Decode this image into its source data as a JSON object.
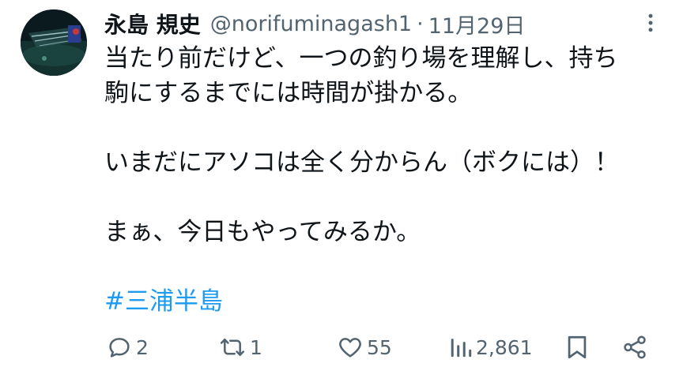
{
  "author": {
    "display_name": "永島 規史",
    "handle": "@norifuminagash1",
    "separator": "·",
    "date": "11月29日"
  },
  "tweet": {
    "lines": [
      "当たり前だけど、一つの釣り場を理解し、持ち",
      "駒にするまでには時間が掛かる。",
      "",
      "いまだにアソコは全く分からん（ボクには）！",
      "",
      "まぁ、今日もやってみるか。",
      ""
    ],
    "hashtag": "#三浦半島"
  },
  "actions": {
    "reply_count": "2",
    "retweet_count": "1",
    "like_count": "55",
    "view_count": "2,861"
  },
  "icons": {
    "more": "more-icon",
    "reply": "reply-icon",
    "retweet": "retweet-icon",
    "like": "heart-icon",
    "views": "views-icon",
    "bookmark": "bookmark-icon",
    "share": "share-icon"
  },
  "colors": {
    "text": "#0f1419",
    "secondary": "#536471",
    "link": "#1d9bf0"
  }
}
